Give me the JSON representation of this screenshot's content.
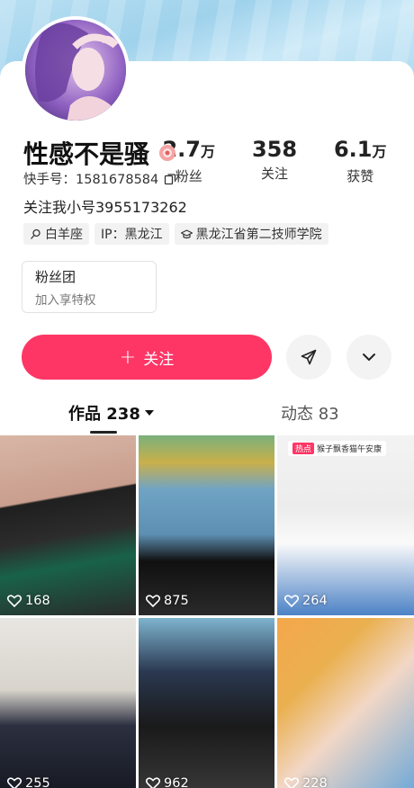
{
  "profile": {
    "name": "性感不是骚",
    "id_line": "快手号：1581678584",
    "bio": "关注我小号3955173262",
    "tags": [
      "白羊座",
      "IP：黑龙江",
      "黑龙江省第二技师学院"
    ]
  },
  "stats": [
    {
      "value": "2.7",
      "unit": "万",
      "label": "粉丝"
    },
    {
      "value": "358",
      "unit": "",
      "label": "关注"
    },
    {
      "value": "6.1",
      "unit": "万",
      "label": "获赞"
    }
  ],
  "fan_group": {
    "title": "粉丝团",
    "subtitle": "加入享特权"
  },
  "actions": {
    "follow_label": "关注",
    "follow_plus": "+"
  },
  "tabs": {
    "works": "作品 238",
    "moments": "动态 83"
  },
  "grid": {
    "hot_badge": "热点",
    "hot_text": "猴子飘香猫午安康",
    "likes": [
      "168",
      "875",
      "264",
      "255",
      "962",
      "228"
    ]
  },
  "colors": {
    "accent": "#fe3666"
  }
}
